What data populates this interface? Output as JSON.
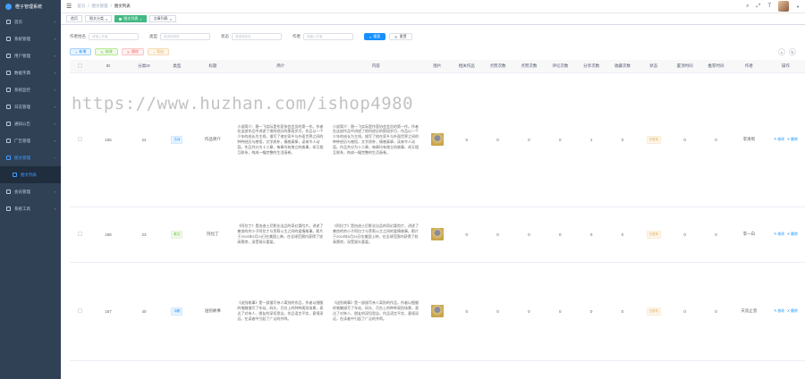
{
  "app": {
    "logo_text": "橙子管理系统"
  },
  "sidebar": {
    "items": [
      {
        "label": "首页",
        "icon": "home-icon"
      },
      {
        "label": "系统管理",
        "icon": "gear-icon"
      },
      {
        "label": "用户管理",
        "icon": "user-icon"
      },
      {
        "label": "数据字典",
        "icon": "dict-icon"
      },
      {
        "label": "系统监控",
        "icon": "monitor-icon"
      },
      {
        "label": "日志管理",
        "icon": "log-icon"
      },
      {
        "label": "通知公告",
        "icon": "bell-icon"
      },
      {
        "label": "广告管理",
        "icon": "ad-icon"
      },
      {
        "label": "图文管理",
        "icon": "image-icon",
        "active": true
      },
      {
        "label": "图文列表",
        "icon": "list-icon",
        "sub": true,
        "active": true
      },
      {
        "label": "会员管理",
        "icon": "member-icon"
      },
      {
        "label": "系统工具",
        "icon": "tool-icon"
      }
    ]
  },
  "header": {
    "breadcrumb": [
      "首页",
      "图文管理",
      "图文列表"
    ]
  },
  "tags": [
    "首页",
    "图文分类",
    "图文列表",
    "文章列表"
  ],
  "search": {
    "fields": [
      {
        "label": "作者姓名",
        "placeholder": "请输入作者"
      },
      {
        "label": "类型",
        "placeholder": "请选择类型"
      },
      {
        "label": "状态",
        "placeholder": "请选择状态"
      },
      {
        "label": "作者",
        "placeholder": "请输入作者"
      }
    ],
    "search_label": "搜索",
    "reset_label": "重置"
  },
  "toolbar": {
    "add": "新增",
    "edit": "修改",
    "delete": "删除",
    "export": "导出"
  },
  "table": {
    "columns": [
      "",
      "ID",
      "分类ID",
      "类型",
      "标题",
      "简介",
      "内容",
      "图片",
      "相关作品",
      "点赞次数",
      "点赞次数",
      "评论次数",
      "分享次数",
      "收藏次数",
      "状态",
      "置顶时间",
      "推荐时间",
      "作者",
      "操作"
    ],
    "rows": [
      {
        "id": "155",
        "cid": "22",
        "type": "古诗",
        "title": "作品简介",
        "summary": "小说简介：聂一飞实际是作家协会会员的第一作。作者在这部作品中讲述了他所经历的那段岁月，作品以一个少年的成长为主线，描写了他在家乡与外面世界之间的种种经历与感悟，文字质朴，情感真挚，读来令人动容。作品共分为十二章，每章均有独立的故事，却又相互联系，构成一幅完整的生活画卷。",
        "content": "小说简介：聂一飞实际是作家协会会员的第一作。作者在这部作品中讲述了他所经历的那段岁月，作品以一个少年的成长为主线，描写了他在家乡与外面世界之间的种种经历与感悟，文字质朴，情感真挚，读来令人动容。作品共分为十二章，每章均有独立的故事，却又相互联系，构成一幅完整的生活画卷。",
        "nums": [
          "0",
          "0",
          "0",
          "0",
          "1",
          "0"
        ],
        "status": "已发布",
        "stick": "0",
        "rec": "0",
        "author": "李清照"
      },
      {
        "id": "156",
        "cid": "23",
        "type": "散文",
        "title": "阿拉丁",
        "summary": "《阿拉丁》是由迪士尼影业出品的奇幻冒险片，讲述了善良的穷小子阿拉丁与茉莉公主之间的爱情故事。影片于2019年5月24日在美国上映，在全球范围内获得了较高票房，深受观众喜爱。",
        "content": "《阿拉丁》是由迪士尼影业出品的奇幻冒险片，讲述了善良的穷小子阿拉丁与茉莉公主之间的爱情故事。影片于2019年5月24日在美国上映，在全球范围内获得了较高票房，深受观众喜爱。",
        "nums": [
          "0",
          "0",
          "0",
          "0",
          "0",
          "0"
        ],
        "status": "已发布",
        "stick": "0",
        "rec": "0",
        "author": "李一白"
      },
      {
        "id": "157",
        "cid": "40",
        "type": "诗歌",
        "title": "送别故事",
        "summary": "《送别故事》是一部描写亲人离别的作品，作者以细腻的笔触描写了车站、码头、月台上的种种离别场景，表达了对亲人、朋友的深切思念。作品语言平实，意境深远，在读者中引起了广泛的共鸣。",
        "content": "《送别故事》是一部描写亲人离别的作品，作者以细腻的笔触描写了车站、码头、月台上的种种离别场景，表达了对亲人、朋友的深切思念。作品语言平实，意境深远，在读者中引起了广泛的共鸣。",
        "nums": [
          "0",
          "0",
          "0",
          "0",
          "0",
          "0"
        ],
        "status": "已发布",
        "stick": "0",
        "rec": "0",
        "author": "天涯止息"
      }
    ],
    "op_edit": "修改",
    "op_delete": "删除"
  },
  "watermark": "https://www.huzhan.com/ishop4980"
}
